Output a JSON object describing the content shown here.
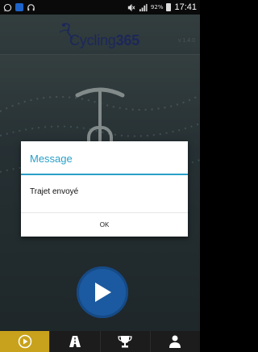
{
  "status_bar": {
    "battery_percent": "92%",
    "time": "17:41",
    "icons": [
      "whatsapp-icon",
      "app-icon",
      "headset-icon",
      "mute-icon",
      "signal-icon",
      "battery-icon"
    ]
  },
  "header": {
    "logo_word": "Cycling",
    "logo_number": "365",
    "version": "v 1.4.0"
  },
  "dialog": {
    "title": "Message",
    "message": "Trajet envoyé",
    "ok_label": "OK"
  },
  "colors": {
    "dialog_accent": "#2aa0c8",
    "play_button": "#1b5aa0",
    "nav_active": "#c8a21c",
    "logo": "#2b3d8a"
  },
  "bottom_nav": {
    "items": [
      {
        "icon": "play-icon",
        "active": true
      },
      {
        "icon": "road-icon",
        "active": false
      },
      {
        "icon": "trophy-icon",
        "active": false
      },
      {
        "icon": "profile-icon",
        "active": false
      }
    ]
  }
}
